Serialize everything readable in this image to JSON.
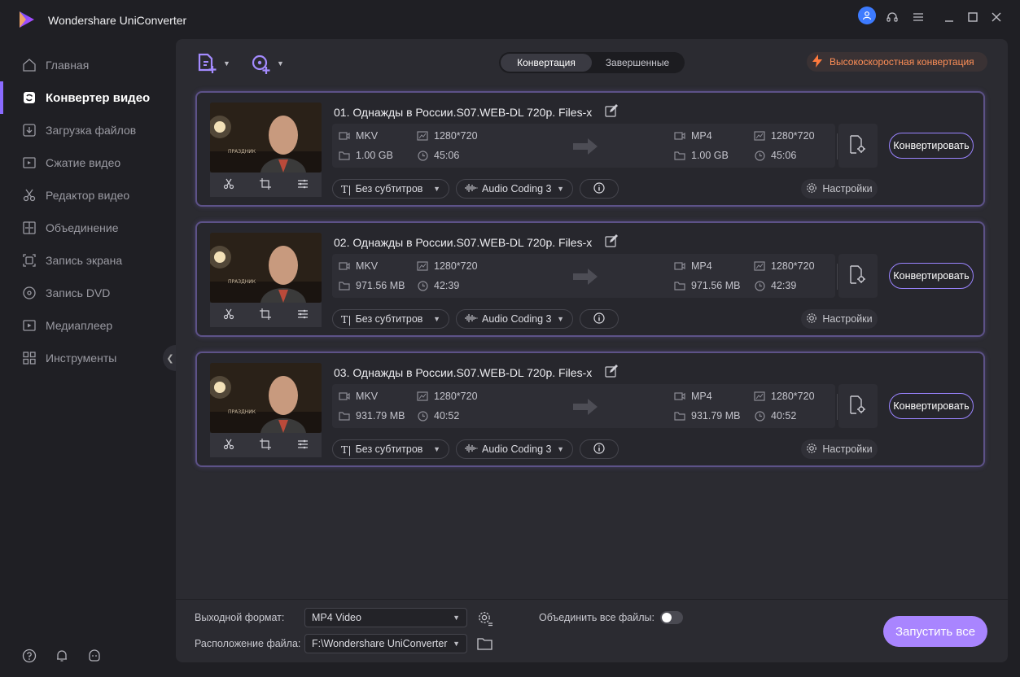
{
  "app": {
    "title": "Wondershare UniConverter"
  },
  "colors": {
    "accent": "#8b6bff",
    "convert_border": "#9a84ff",
    "start_button": "#a985ff",
    "highspeed_text": "#ff8f57",
    "user_avatar": "#3d7bff"
  },
  "sidebar": {
    "items": [
      {
        "label": "Главная",
        "icon": "home-icon",
        "active": false
      },
      {
        "label": "Конвертер видео",
        "icon": "video-converter-icon",
        "active": true
      },
      {
        "label": "Загрузка файлов",
        "icon": "download-icon",
        "active": false
      },
      {
        "label": "Сжатие видео",
        "icon": "compress-icon",
        "active": false
      },
      {
        "label": "Редактор видео",
        "icon": "scissors-icon",
        "active": false
      },
      {
        "label": "Объединение",
        "icon": "merge-icon",
        "active": false
      },
      {
        "label": "Запись экрана",
        "icon": "screen-record-icon",
        "active": false
      },
      {
        "label": "Запись DVD",
        "icon": "dvd-icon",
        "active": false
      },
      {
        "label": "Медиаплеер",
        "icon": "media-player-icon",
        "active": false
      },
      {
        "label": "Инструменты",
        "icon": "tools-icon",
        "active": false
      }
    ]
  },
  "tabs": {
    "convert": "Конвертация",
    "finished": "Завершенные"
  },
  "highspeed": {
    "label": "Высокоскоростная конвертация"
  },
  "files": [
    {
      "title": "01. Однажды в России.S07.WEB-DL 720p. Files-x",
      "src": {
        "format": "MKV",
        "resolution": "1280*720",
        "size": "1.00 GB",
        "duration": "45:06"
      },
      "dst": {
        "format": "MP4",
        "resolution": "1280*720",
        "size": "1.00 GB",
        "duration": "45:06"
      },
      "subtitle": "Без субтитров",
      "audio": "Audio Coding 3",
      "settings": "Настройки",
      "convert": "Конвертировать"
    },
    {
      "title": "02. Однажды в России.S07.WEB-DL 720p. Files-x",
      "src": {
        "format": "MKV",
        "resolution": "1280*720",
        "size": "971.56 MB",
        "duration": "42:39"
      },
      "dst": {
        "format": "MP4",
        "resolution": "1280*720",
        "size": "971.56 MB",
        "duration": "42:39"
      },
      "subtitle": "Без субтитров",
      "audio": "Audio Coding 3",
      "settings": "Настройки",
      "convert": "Конвертировать"
    },
    {
      "title": "03. Однажды в России.S07.WEB-DL 720p. Files-x",
      "src": {
        "format": "MKV",
        "resolution": "1280*720",
        "size": "931.79 MB",
        "duration": "40:52"
      },
      "dst": {
        "format": "MP4",
        "resolution": "1280*720",
        "size": "931.79 MB",
        "duration": "40:52"
      },
      "subtitle": "Без субтитров",
      "audio": "Audio Coding 3",
      "settings": "Настройки",
      "convert": "Конвертировать"
    }
  ],
  "footer": {
    "output_label": "Выходной формат:",
    "output_value": "MP4 Video",
    "merge_label": "Объединить все файлы:",
    "merge_on": false,
    "location_label": "Расположение файла:",
    "location_value": "F:\\Wondershare UniConverter",
    "start_all": "Запустить все"
  }
}
